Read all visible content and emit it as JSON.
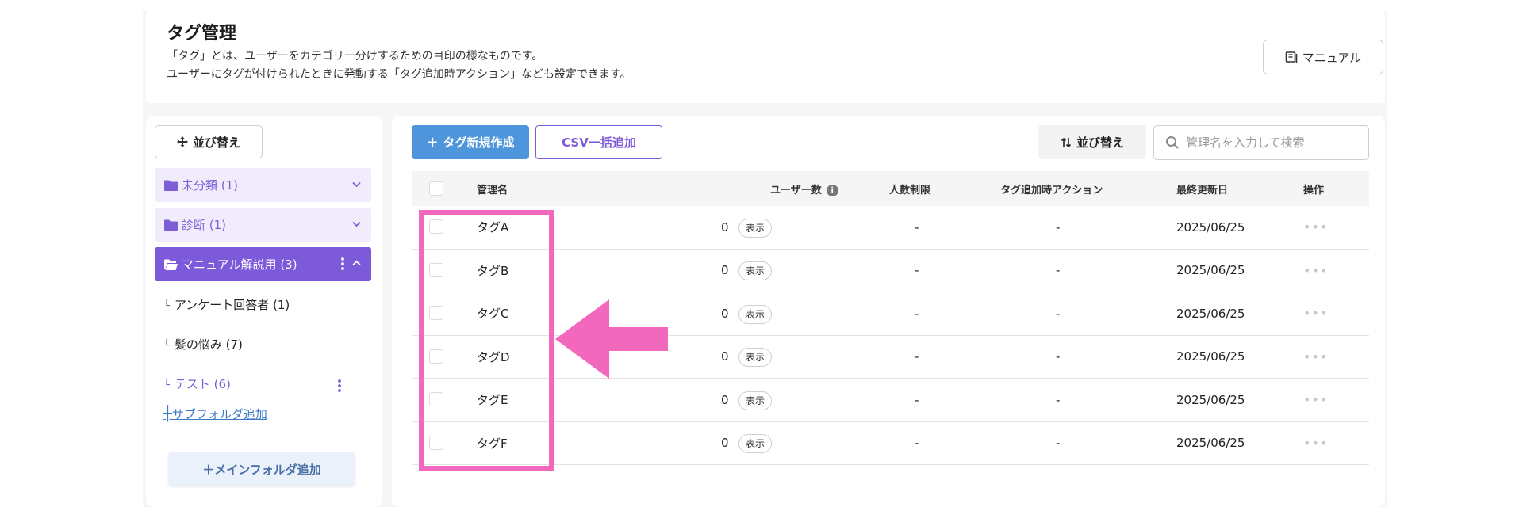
{
  "header": {
    "title": "タグ管理",
    "description_line1": "「タグ」とは、ユーザーをカテゴリー分けするための目印の様なものです。",
    "description_line2": "ユーザーにタグが付けられたときに発動する「タグ追加時アクション」なども設定できます。",
    "manual_label": "マニュアル"
  },
  "sidebar": {
    "sort_label": "並び替え",
    "folders": [
      {
        "label": "未分類 (1)"
      },
      {
        "label": "診断 (1)"
      },
      {
        "label": "マニュアル解説用 (3)"
      }
    ],
    "subitems": [
      {
        "label": "アンケート回答者 (1)"
      },
      {
        "label": "髪の悩み (7)"
      },
      {
        "label": "テスト (6)"
      }
    ],
    "add_subfolder_label": "サブフォルダ追加",
    "add_main_folder_label": "＋メインフォルダ追加"
  },
  "toolbar": {
    "new_tag_label": "タグ新規作成",
    "csv_label": "CSV一括追加",
    "sort_label": "並び替え",
    "search_placeholder": "管理名を入力して検索"
  },
  "table": {
    "columns": {
      "name": "管理名",
      "users": "ユーザー数",
      "limit": "人数制限",
      "action": "タグ追加時アクション",
      "updated": "最終更新日",
      "ops": "操作"
    },
    "show_label": "表示",
    "rows": [
      {
        "name": "タグA",
        "users": "0",
        "limit": "-",
        "action": "-",
        "updated": "2025/06/25"
      },
      {
        "name": "タグB",
        "users": "0",
        "limit": "-",
        "action": "-",
        "updated": "2025/06/25"
      },
      {
        "name": "タグC",
        "users": "0",
        "limit": "-",
        "action": "-",
        "updated": "2025/06/25"
      },
      {
        "name": "タグD",
        "users": "0",
        "limit": "-",
        "action": "-",
        "updated": "2025/06/25"
      },
      {
        "name": "タグE",
        "users": "0",
        "limit": "-",
        "action": "-",
        "updated": "2025/06/25"
      },
      {
        "name": "タグF",
        "users": "0",
        "limit": "-",
        "action": "-",
        "updated": "2025/06/25"
      }
    ]
  },
  "colors": {
    "accent_purple": "#7c5ad9",
    "accent_blue": "#4f95dc",
    "annotation_pink": "#f268bd"
  }
}
